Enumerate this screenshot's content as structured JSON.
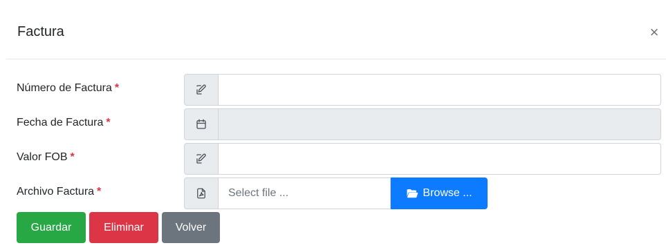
{
  "modal": {
    "title": "Factura",
    "close_symbol": "×"
  },
  "form": {
    "required_marker": "*",
    "fields": [
      {
        "label": "Número de Factura",
        "icon": "edit-icon",
        "value": "",
        "disabled": false
      },
      {
        "label": "Fecha de Factura",
        "icon": "calendar-icon",
        "value": "",
        "disabled": true
      },
      {
        "label": "Valor FOB",
        "icon": "edit-icon",
        "value": "",
        "disabled": false
      },
      {
        "label": "Archivo Factura",
        "icon": "pdf-file-icon",
        "file_placeholder": "Select file ...",
        "browse_label": "Browse ..."
      }
    ]
  },
  "actions": {
    "save_label": "Guardar",
    "delete_label": "Eliminar",
    "back_label": "Volver"
  },
  "colors": {
    "save": "#28a745",
    "delete": "#dc3545",
    "back": "#6c757d",
    "browse": "#0d7bff",
    "required": "#dc3545"
  }
}
